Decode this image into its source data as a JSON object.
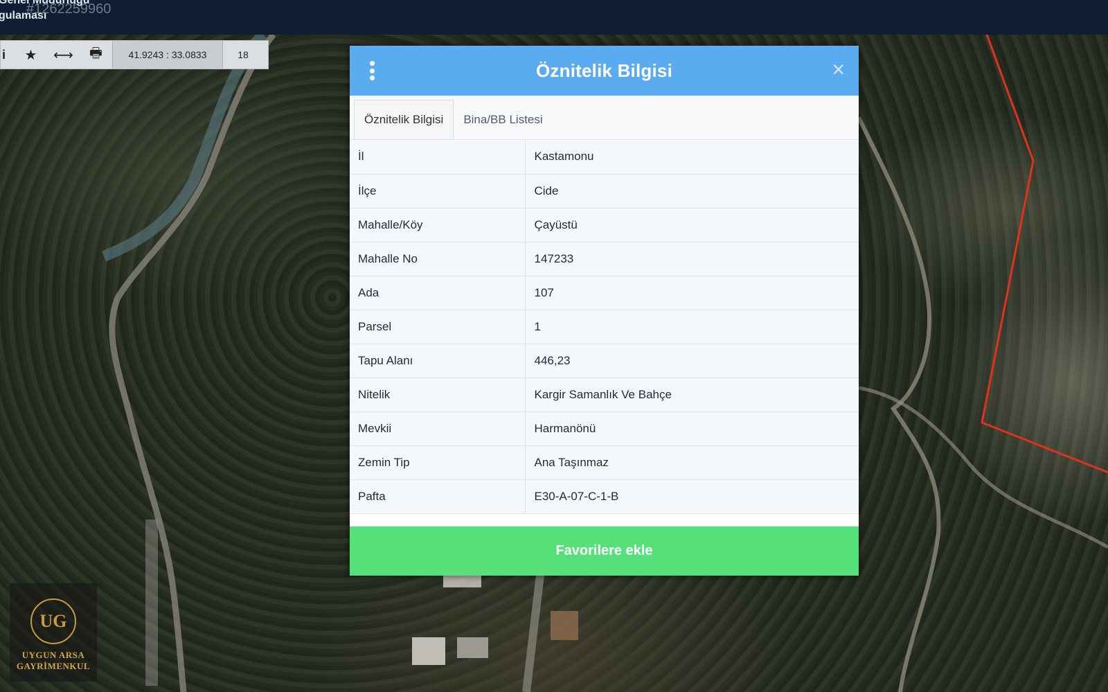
{
  "topbar": {
    "line1": "Genel Müdürlüğü",
    "line2": "gulaması",
    "watermark": "#1262259960"
  },
  "toolbar": {
    "info_icon": "info-icon",
    "star_icon": "star-icon",
    "measure_icon": "arrows-horizontal-icon",
    "print_icon": "print-icon",
    "coordinates": "41.9243 : 33.0833",
    "zoom": "18"
  },
  "modal": {
    "title": "Öznitelik Bilgisi",
    "menu_icon": "kebab-menu-icon",
    "close_icon": "close-icon",
    "close_glyph": "×",
    "tabs": [
      {
        "label": "Öznitelik Bilgisi",
        "active": true
      },
      {
        "label": "Bina/BB Listesi",
        "active": false
      }
    ],
    "rows": [
      {
        "key": "İl",
        "value": "Kastamonu"
      },
      {
        "key": "İlçe",
        "value": "Cide"
      },
      {
        "key": "Mahalle/Köy",
        "value": "Çayüstü"
      },
      {
        "key": "Mahalle No",
        "value": "147233"
      },
      {
        "key": "Ada",
        "value": "107"
      },
      {
        "key": "Parsel",
        "value": "1"
      },
      {
        "key": "Tapu Alanı",
        "value": "446,23"
      },
      {
        "key": "Nitelik",
        "value": "Kargir Samanlık Ve Bahçe"
      },
      {
        "key": "Mevkii",
        "value": "Harmanönü"
      },
      {
        "key": "Zemin Tip",
        "value": "Ana Taşınmaz"
      },
      {
        "key": "Pafta",
        "value": "E30-A-07-C-1-B"
      }
    ],
    "favorite_button": "Favorilere ekle"
  },
  "logo": {
    "mark": "UG",
    "line1": "UYGUN ARSA",
    "line2": "GAYRİMENKUL"
  },
  "colors": {
    "header": "#5aabf0",
    "favorite": "#55e07a",
    "parcel_border": "#e0321e"
  }
}
